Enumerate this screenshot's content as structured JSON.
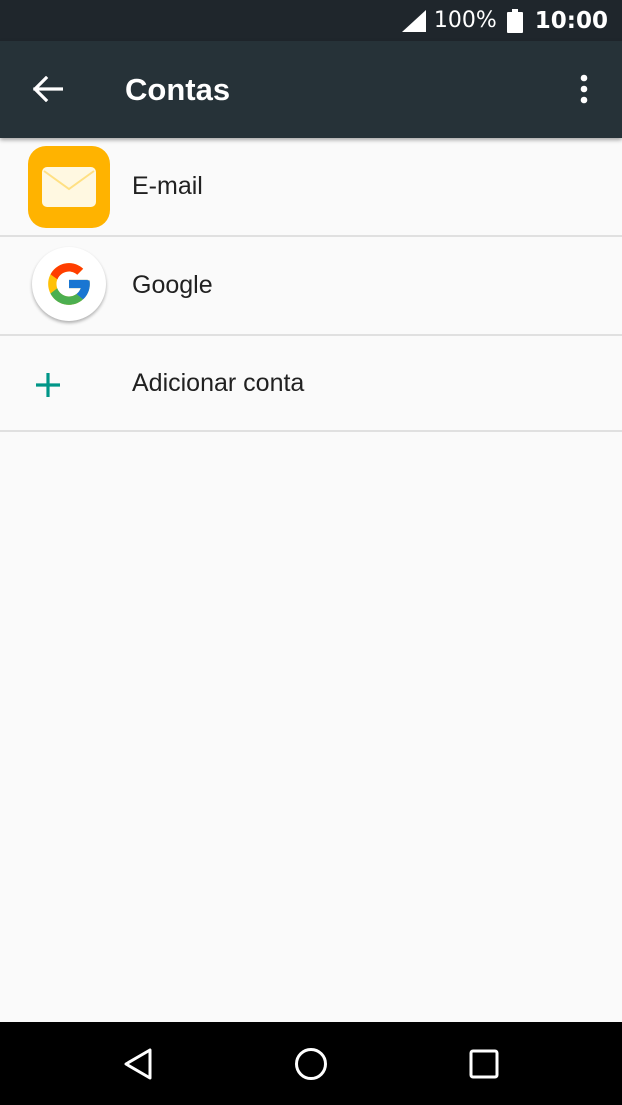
{
  "status_bar": {
    "battery_percent": "100%",
    "time": "10:00",
    "icons": [
      "signal-icon",
      "battery-icon"
    ]
  },
  "app_bar": {
    "title": "Contas",
    "icons": [
      "arrow-back-icon",
      "more-vert-icon"
    ]
  },
  "accounts": {
    "items": [
      {
        "label": "E-mail",
        "icon": "email-app-icon"
      },
      {
        "label": "Google",
        "icon": "google-icon"
      }
    ],
    "add_account": {
      "label": "Adicionar conta",
      "icon": "plus-icon"
    }
  },
  "nav_bar": {
    "icons": [
      "back-triangle-icon",
      "home-circle-icon",
      "recents-square-icon"
    ]
  },
  "colors": {
    "status_bar_bg": "#1f262c",
    "app_bar_bg": "#263238",
    "email_icon_bg": "#ffb300",
    "accent_teal": "#009688",
    "background": "#fafafa"
  }
}
